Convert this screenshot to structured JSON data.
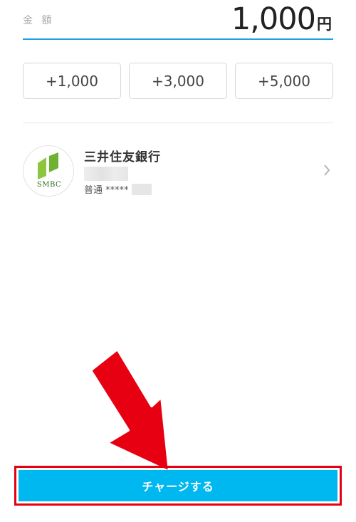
{
  "amount": {
    "label": "金 額",
    "value": "1,000",
    "unit": "円"
  },
  "quick_add": [
    {
      "label": "+1,000"
    },
    {
      "label": "+3,000"
    },
    {
      "label": "+5,000"
    }
  ],
  "bank": {
    "logo_text": "SMBC",
    "name": "三井住友銀行",
    "account": "普通 *****"
  },
  "actions": {
    "charge_label": "チャージする"
  },
  "colors": {
    "accent_blue": "#1ba1e2",
    "button_blue": "#00b8f0",
    "annotation_red": "#e60012",
    "logo_green": "#8cc63f"
  }
}
